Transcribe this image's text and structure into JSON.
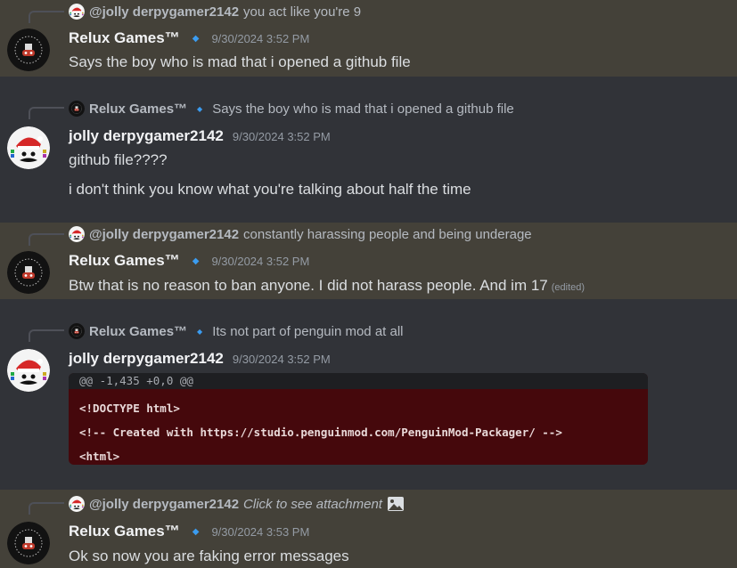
{
  "messages": [
    {
      "reply": {
        "name": "@jolly derpygamer2142",
        "text": "you act like you're 9"
      },
      "author": "Relux Games™",
      "timestamp": "9/30/2024 3:52 PM",
      "lines": [
        "Says the boy who is mad that i opened a github file"
      ]
    },
    {
      "reply": {
        "name": "Relux Games™",
        "text": "Says the boy who is mad that i opened a github file"
      },
      "author": "jolly derpygamer2142",
      "timestamp": "9/30/2024 3:52 PM",
      "lines": [
        "github file????",
        "i don't think you know what you're talking about half the time"
      ]
    },
    {
      "reply": {
        "name": "@jolly derpygamer2142",
        "text": "constantly harassing people and being underage"
      },
      "author": "Relux Games™",
      "timestamp": "9/30/2024 3:52 PM",
      "lines": [
        "Btw that is no reason to ban anyone. I did not harass people. And im 17"
      ],
      "edited": "(edited)"
    },
    {
      "reply": {
        "name": "Relux Games™",
        "text": "Its not part of penguin mod at all"
      },
      "author": "jolly derpygamer2142",
      "timestamp": "9/30/2024 3:52 PM",
      "code": {
        "hunk": "@@ -1,435 +0,0 @@",
        "lines": [
          "<!DOCTYPE html>",
          "<!-- Created with https://studio.penguinmod.com/PenguinMod-Packager/ -->",
          "<html>"
        ]
      }
    },
    {
      "reply": {
        "name": "@jolly derpygamer2142",
        "text": "Click to see attachment"
      },
      "author": "Relux Games™",
      "timestamp": "9/30/2024 3:53 PM",
      "lines": [
        "Ok so now you are faking error messages"
      ]
    }
  ],
  "badge_icon": "diamond-icon",
  "colors": {
    "highlight": "#444139",
    "background": "#313338",
    "badge": "#3b9cf0",
    "code_bg": "#45080c"
  }
}
